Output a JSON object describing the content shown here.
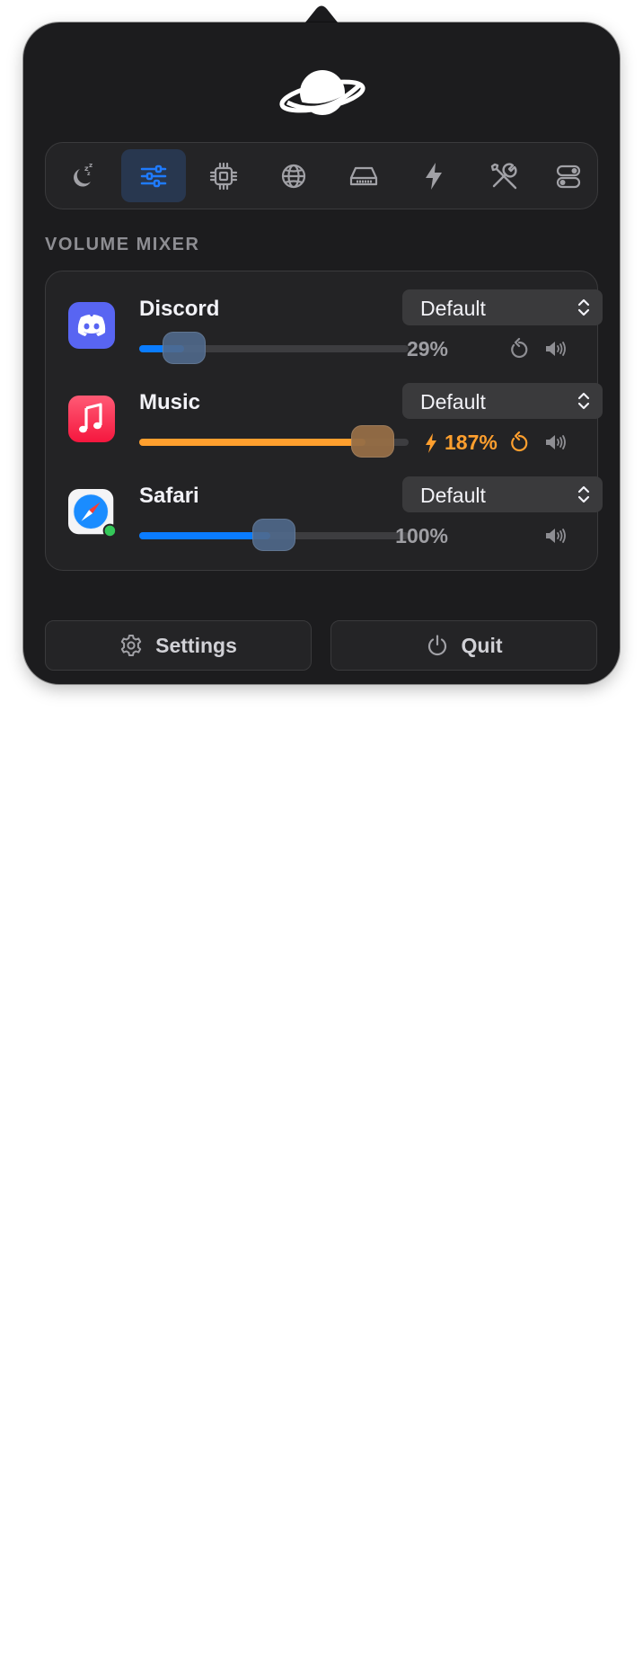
{
  "toolbar": {
    "tools": [
      {
        "icon": "sleep-moon-icon",
        "active": false
      },
      {
        "icon": "sliders-icon",
        "active": true
      },
      {
        "icon": "cpu-chip-icon",
        "active": false
      },
      {
        "icon": "globe-icon",
        "active": false
      },
      {
        "icon": "disk-drive-icon",
        "active": false
      },
      {
        "icon": "bolt-icon",
        "active": false
      },
      {
        "icon": "tools-icon",
        "active": false
      },
      {
        "icon": "toggles-icon",
        "active": false
      }
    ]
  },
  "mixer": {
    "title": "VOLUME MIXER",
    "apps": [
      {
        "name": "Discord",
        "device": "Default",
        "volume_label": "29%",
        "volume_percent": 29,
        "boosted": false,
        "show_reset": true,
        "icon": "discord-icon"
      },
      {
        "name": "Music",
        "device": "Default",
        "volume_label": "187%",
        "volume_percent": 187,
        "boosted": true,
        "show_reset": true,
        "icon": "music-note-icon"
      },
      {
        "name": "Safari",
        "device": "Default",
        "volume_label": "100%",
        "volume_percent": 100,
        "boosted": false,
        "show_reset": false,
        "icon": "safari-compass-icon",
        "active_indicator": true
      }
    ]
  },
  "footer": {
    "settings_label": "Settings",
    "quit_label": "Quit"
  },
  "colors": {
    "accent_blue": "#0a7cff",
    "boost_orange": "#ff9f2e",
    "panel_bg": "#1c1c1e",
    "active_green": "#34c759"
  }
}
